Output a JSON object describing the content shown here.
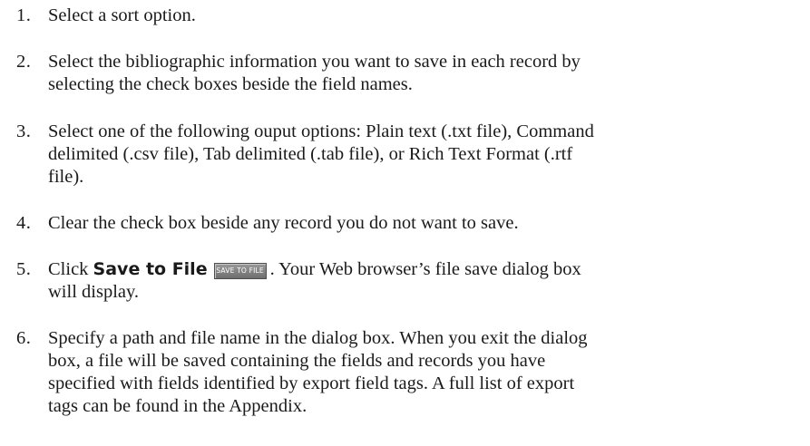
{
  "steps": [
    {
      "number": "1.",
      "lines": [
        "Select a sort option."
      ]
    },
    {
      "number": "2.",
      "lines": [
        "Select the bibliographic information you want to save in each record by",
        "selecting the check boxes beside the field names."
      ]
    },
    {
      "number": "3.",
      "lines": [
        "Select one of the following ouput options: Plain text (.txt file), Command",
        "delimited (.csv file), Tab delimited (.tab file), or Rich Text Format (.rtf",
        "file)."
      ]
    },
    {
      "number": "4.",
      "lines": [
        "Clear the check box beside any record you do not want to save."
      ]
    },
    {
      "number": "5.",
      "prefix": "Click ",
      "bold_label": "Save to File",
      "button_label": "SAVE TO FILE",
      "suffix": ". Your Web browser’s file save dialog box",
      "line2": "will display."
    },
    {
      "number": "6.",
      "lines": [
        "Specify a path and file name in the dialog box. When you exit the dialog",
        "box, a file will be saved containing the fields and records you have",
        "specified with fields identified by export field tags. A full list of export",
        "tags can be found in the Appendix."
      ]
    }
  ]
}
